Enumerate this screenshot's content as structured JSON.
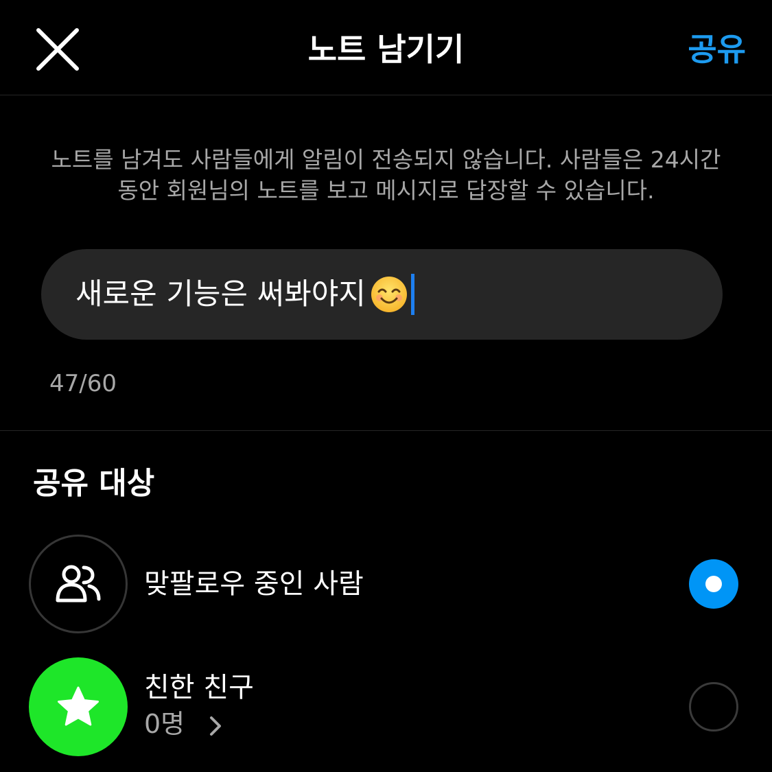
{
  "header": {
    "title": "노트 남기기",
    "share_label": "공유"
  },
  "info": {
    "line1": "노트를 남겨도 사람들에게 알림이 전송되지 않습니다. 사람들은 24시간",
    "line2": "동안 회원님의 노트를 보고 메시지로 답장할 수 있습니다."
  },
  "note": {
    "value": "새로운 기능은 써봐야지",
    "emoji": "smiling-face-emoji",
    "counter": "47/60"
  },
  "audience": {
    "title": "공유 대상",
    "options": [
      {
        "label": "맞팔로우 중인 사람",
        "icon": "people-icon",
        "selected": true
      },
      {
        "label": "친한 친구",
        "sub": "0명",
        "icon": "star-icon",
        "selected": false
      }
    ]
  },
  "colors": {
    "background": "#000000",
    "accent": "#1d9bf0",
    "radio_selected": "#0095f6",
    "close_friends_green": "#1ee629",
    "input_bg": "#262626",
    "secondary_text": "#a8a8a8",
    "caret": "#1d7ff0"
  }
}
